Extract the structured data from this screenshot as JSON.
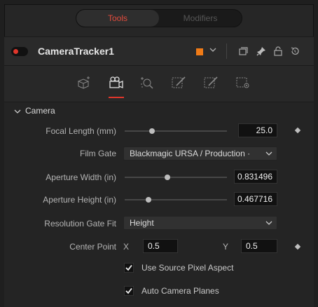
{
  "tabs": {
    "tools": "Tools",
    "modifiers": "Modifiers"
  },
  "tool": {
    "name": "CameraTracker1",
    "enabled": true,
    "color_swatch": "#f07b17",
    "header_icons": [
      "chevron-down-icon",
      "window-icon",
      "pin-icon",
      "lock-icon",
      "reset-icon"
    ]
  },
  "panel_tabs": [
    {
      "icon": "track-icon",
      "active": false
    },
    {
      "icon": "camera-icon",
      "active": true
    },
    {
      "icon": "solve-icon",
      "active": false
    },
    {
      "icon": "export-icon",
      "active": false
    },
    {
      "icon": "options-icon",
      "active": false
    },
    {
      "icon": "settings-icon",
      "active": false
    }
  ],
  "section": {
    "title": "Camera"
  },
  "focal_length": {
    "label": "Focal Length (mm)",
    "value": "25.0",
    "slider_fraction": 0.27
  },
  "film_gate": {
    "label": "Film Gate",
    "value": "Blackmagic URSA / Production ·"
  },
  "aperture_width": {
    "label": "Aperture Width (in)",
    "value": "0.831496",
    "slider_fraction": 0.42
  },
  "aperture_height": {
    "label": "Aperture Height (in)",
    "value": "0.467716",
    "slider_fraction": 0.23
  },
  "resolution_gate_fit": {
    "label": "Resolution Gate Fit",
    "value": "Height"
  },
  "center_point": {
    "label": "Center Point",
    "x_label": "X",
    "x_value": "0.5",
    "y_label": "Y",
    "y_value": "0.5"
  },
  "checkboxes": {
    "source_pixel_aspect": {
      "label": "Use Source Pixel Aspect",
      "checked": true
    },
    "auto_camera_planes": {
      "label": "Auto Camera Planes",
      "checked": true
    }
  },
  "colors": {
    "accent_red": "#e0362b",
    "tab_active_text": "#e24b3c"
  }
}
